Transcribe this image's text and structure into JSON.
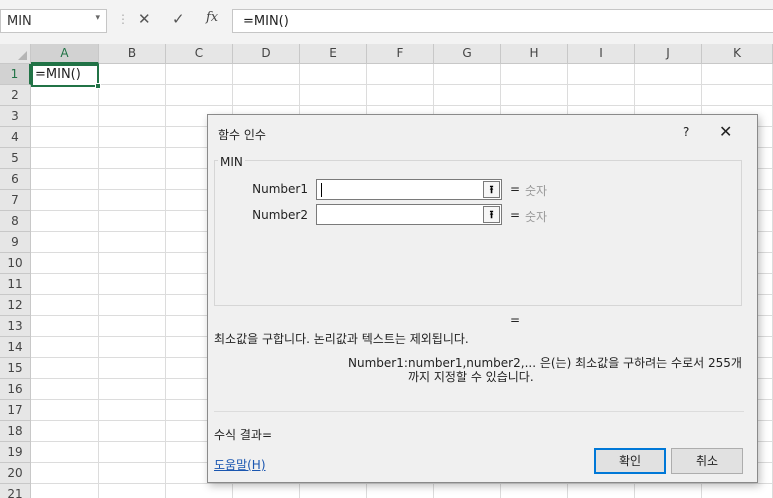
{
  "formula_bar": {
    "name_box": "MIN",
    "name_box_arrow": "▾",
    "separator": "⋮",
    "cancel_glyph": "✕",
    "enter_glyph": "✓",
    "fx_glyph": "fx",
    "formula": "=MIN()"
  },
  "grid": {
    "columns": [
      "A",
      "B",
      "C",
      "D",
      "E",
      "F",
      "G",
      "H",
      "I",
      "J",
      "K"
    ],
    "rows": [
      "1",
      "2",
      "3",
      "4",
      "5",
      "6",
      "7",
      "8",
      "9",
      "10",
      "11",
      "12",
      "13",
      "14",
      "15",
      "16",
      "17",
      "18",
      "19",
      "20",
      "21"
    ],
    "active_column": "A",
    "active_row": "1",
    "active_cell_value": "=MIN()"
  },
  "dialog": {
    "title": "함수 인수",
    "help_glyph": "?",
    "close_glyph": "✕",
    "function_name": "MIN",
    "arguments": [
      {
        "label": "Number1",
        "value": "",
        "ref_glyph": "⭱",
        "equals": "=",
        "type": "숫자"
      },
      {
        "label": "Number2",
        "value": "",
        "ref_glyph": "⭱",
        "equals": "=",
        "type": "숫자"
      }
    ],
    "result_equals": "=",
    "description": "최소값을 구합니다. 논리값과 텍스트는 제외됩니다.",
    "arg_help_name": "Number1:",
    "arg_help_text": "number1,number2,... 은(는) 최소값을 구하려는 수로서 255개까지 지정할 수 있습니다.",
    "formula_result": "수식 결과=",
    "help_link": "도움말(H)",
    "ok_label": "확인",
    "cancel_label": "취소"
  },
  "colors": {
    "accent": "#217346",
    "dialog_focus": "#0078d7",
    "link": "#1a56b0"
  }
}
